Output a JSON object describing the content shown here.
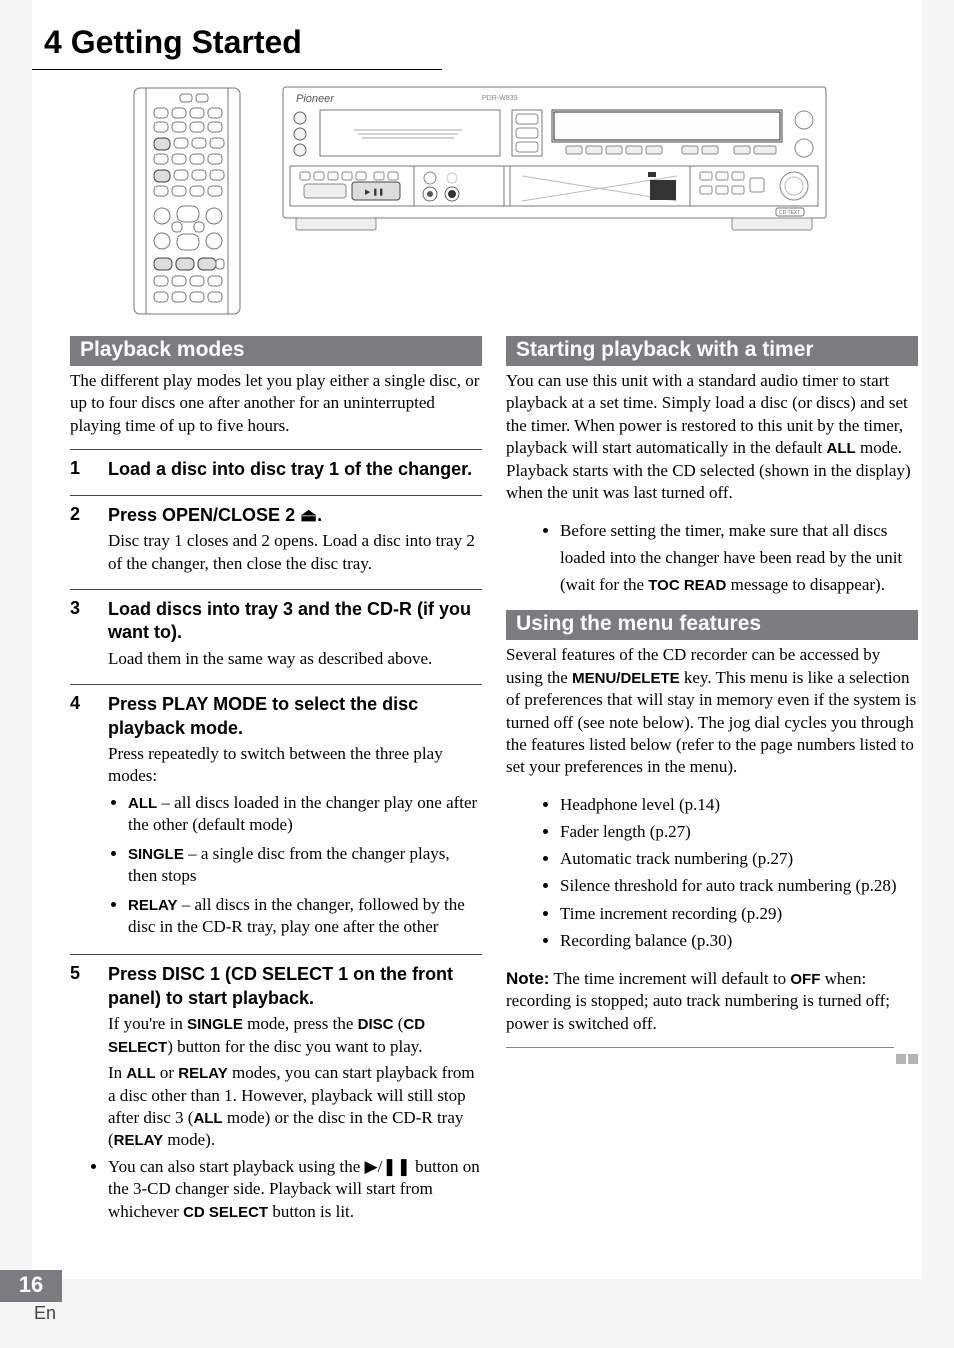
{
  "chapter": {
    "title": "4 Getting Started"
  },
  "page_number": "16",
  "lang": "En",
  "left": {
    "section1": {
      "header": "Playback modes",
      "intro": "The different play modes let you play either a single disc, or up to four discs one after another for an uninterrupted playing time of up to five hours."
    },
    "steps": {
      "s1": {
        "num": "1",
        "title": "Load a disc into disc tray 1 of the changer."
      },
      "s2": {
        "num": "2",
        "title": "Press OPEN/CLOSE 2 ⏏.",
        "desc": "Disc tray 1 closes and 2 opens. Load a disc into tray 2 of the changer, then close the disc tray."
      },
      "s3": {
        "num": "3",
        "title": "Load discs into tray 3 and the CD-R (if you want to).",
        "desc": "Load them in the same way as described above."
      },
      "s4": {
        "num": "4",
        "title": "Press PLAY MODE to select the disc playback mode.",
        "desc": "Press repeatedly to switch between the three play modes:",
        "all_k": "ALL",
        "all_v": " – all discs loaded in the changer play one after the other (default mode)",
        "single_k": "SINGLE",
        "single_v": " – a single disc from the changer plays, then stops",
        "relay_k": "RELAY",
        "relay_v": " – all discs in the changer, followed by the disc in the CD-R tray, play one after the other"
      },
      "s5": {
        "num": "5",
        "title": "Press DISC 1 (CD SELECT 1 on the front panel) to start playback.",
        "p1a": "If you're in ",
        "p1_single": "SINGLE",
        "p1b": " mode, press the ",
        "p1_disc": "DISC",
        "p1c": " (",
        "p1_cdsel": "CD SELECT",
        "p1d": ") button for the disc you want to play.",
        "p2a": "In ",
        "p2_all": "ALL",
        "p2b": " or ",
        "p2_relay": "RELAY",
        "p2c": " modes, you can start playback from a disc other than 1. However, playback will still stop after disc 3 (",
        "p2_all2": "ALL",
        "p2d": " mode) or the disc in the CD-R tray (",
        "p2_relay2": "RELAY",
        "p2e": " mode).",
        "b1a": "You can also start playback using the ▶/❚❚ button on the 3-CD changer side. Playback will start from whichever ",
        "b1_cdsel": "CD SELECT",
        "b1b": " button is lit."
      }
    }
  },
  "right": {
    "section1": {
      "header": "Starting playback with a timer",
      "p1a": "You can use this unit with a standard audio timer to start playback at a set time. Simply load a disc (or discs) and set the timer. When power is restored to this unit by the timer, playback will start automatically in the default ",
      "p1_all": "ALL",
      "p1b": " mode. Playback starts with the CD selected (shown in the display) when the unit was last turned off.",
      "b1a": "Before setting the timer, make sure that all discs loaded into the changer have been read by the unit (wait for the ",
      "b1_toc": "TOC READ",
      "b1b": " message to disappear)."
    },
    "section2": {
      "header": "Using the menu features",
      "p1a": "Several features of the CD recorder can be accessed by using the ",
      "p1_menu": "MENU/DELETE",
      "p1b": " key. This menu is like a selection of preferences that will stay in memory even if the system is turned off (see note below). The jog dial cycles you through the features listed below (refer to the page numbers listed to set your preferences in the menu).",
      "items": {
        "i1": "Headphone level (p.14)",
        "i2": "Fader length (p.27)",
        "i3": "Automatic track numbering (p.27)",
        "i4": "Silence threshold for auto track numbering (p.28)",
        "i5": "Time increment recording (p.29)",
        "i6": "Recording balance (p.30)"
      },
      "note_k": "Note:",
      "note_v1": " The time increment will default to ",
      "note_off": "OFF",
      "note_v2": " when: recording is stopped; auto track numbering is turned off; power is switched off."
    }
  }
}
